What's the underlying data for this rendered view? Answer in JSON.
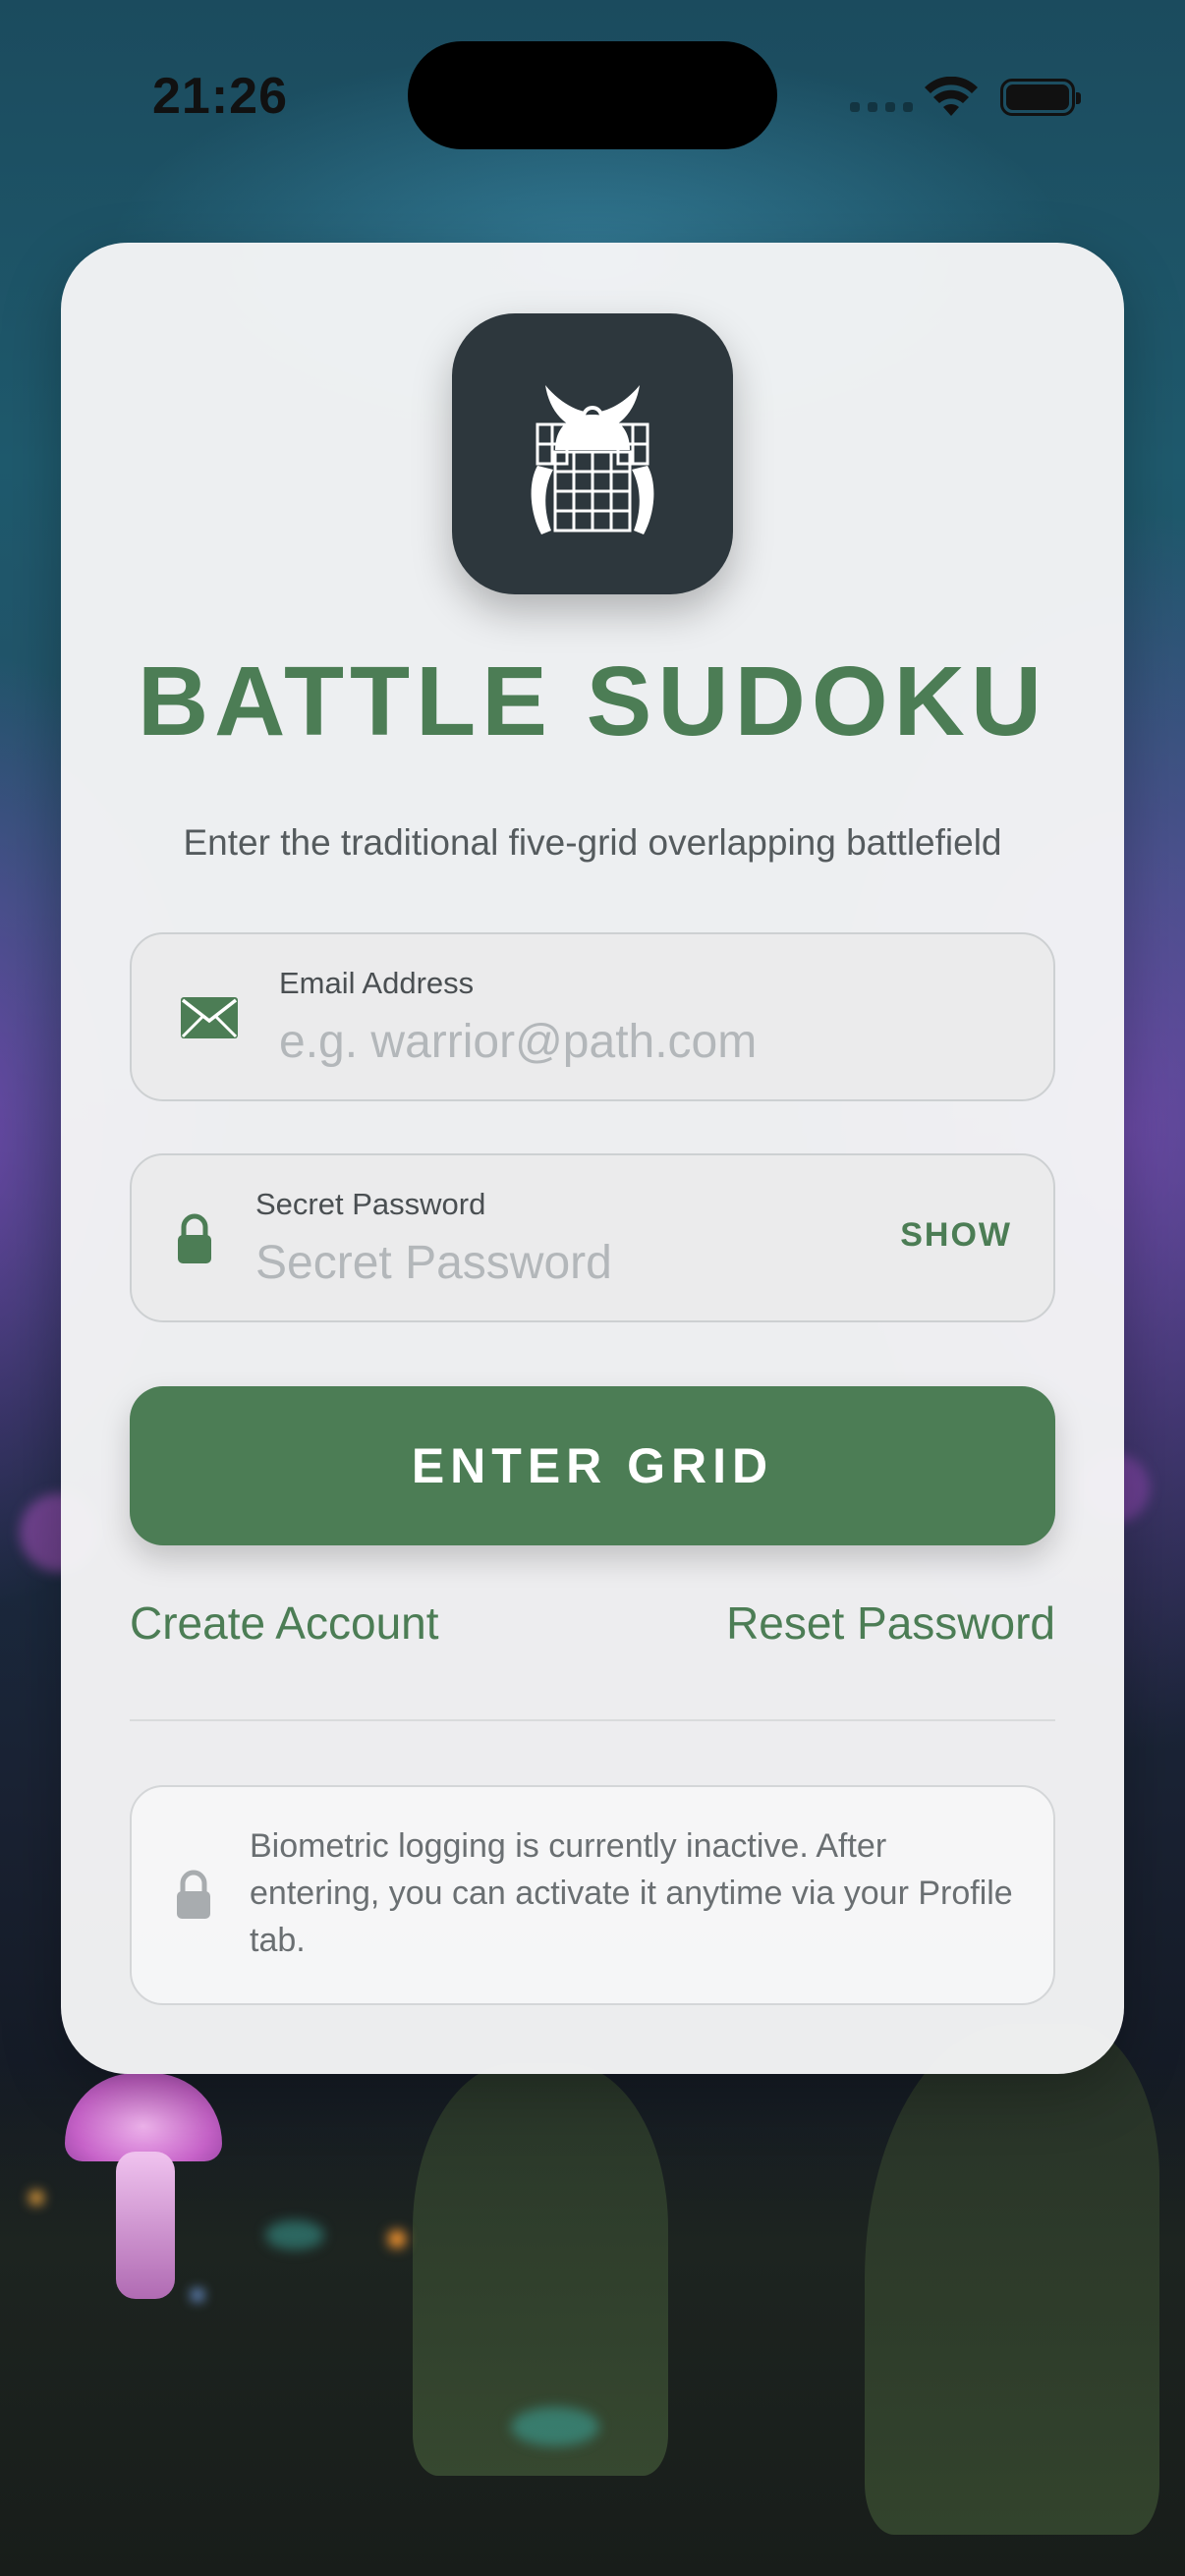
{
  "status_bar": {
    "time": "21:26"
  },
  "login": {
    "title": "BATTLE SUDOKU",
    "subtitle": "Enter the traditional five-grid overlapping battlefield",
    "email_field": {
      "label": "Email Address",
      "placeholder": "e.g. warrior@path.com"
    },
    "password_field": {
      "label": "Secret Password",
      "placeholder": "Secret Password",
      "toggle_label": "SHOW"
    },
    "submit_label": "ENTER GRID",
    "create_account_label": "Create Account",
    "reset_password_label": "Reset Password",
    "biometric_notice": "Biometric logging is currently inactive. After entering, you can activate it anytime via your Profile tab."
  },
  "colors": {
    "accent": "#4c7d55",
    "icon_tile": "#2d373d",
    "card": "#f6f6f7"
  },
  "icons": [
    "mail-icon",
    "lock-icon",
    "samurai-grid-logo",
    "wifi-icon",
    "battery-icon"
  ]
}
